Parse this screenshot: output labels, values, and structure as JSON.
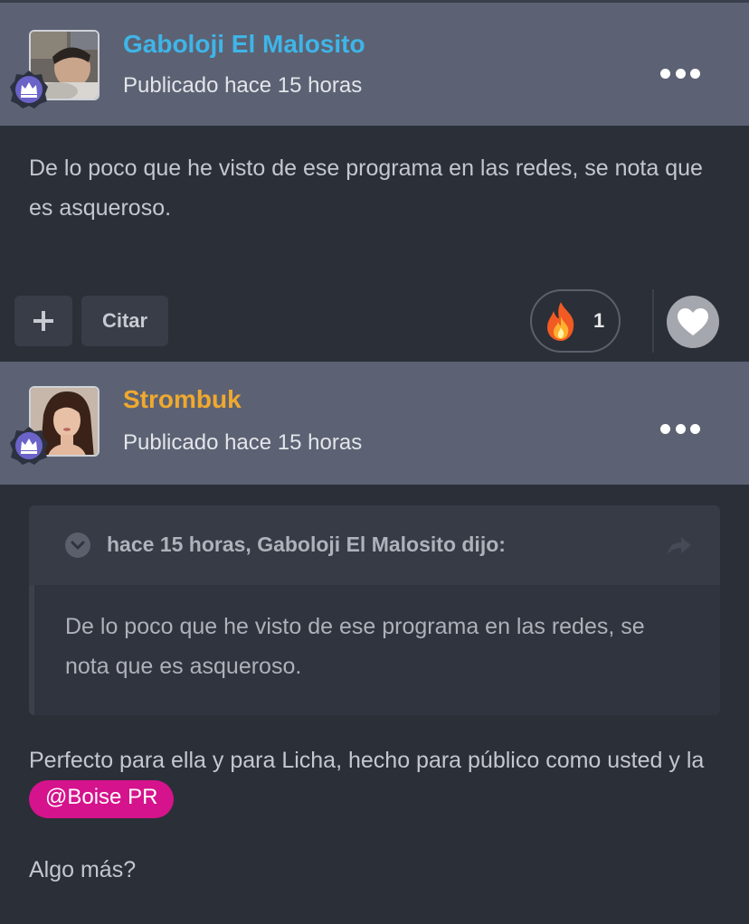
{
  "colors": {
    "author1": "#3fb5e8",
    "author2": "#f0a92e",
    "mention_bg": "#d5138c",
    "header_bg": "#5c6273",
    "page_bg": "#2b2f38"
  },
  "icons": {
    "badge": "crown-badge-icon",
    "more": "more-options-icon",
    "plus": "plus-icon",
    "reaction": "fire-emoji-icon",
    "heart": "heart-icon",
    "toggle": "chevron-down-icon",
    "share": "share-arrow-icon"
  },
  "posts": [
    {
      "author": "Gaboloji El Malosito",
      "posted": "Publicado hace 15 horas",
      "body": "De lo poco que he visto de ese programa en las redes, se nota que es asqueroso.",
      "actions": {
        "plus_label": "+",
        "quote_label": "Citar",
        "reaction_count": "1"
      }
    },
    {
      "author": "Strombuk",
      "posted": "Publicado hace 15 horas",
      "quote": {
        "meta": "hace 15 horas, Gaboloji El Malosito dijo:",
        "body": "De lo poco que he visto de ese programa en las redes, se nota que es asqueroso."
      },
      "body_part1": "Perfecto para ella y para Licha, hecho para público como usted y la",
      "mention": "@Boise PR",
      "body_part2": "Algo más?"
    }
  ]
}
